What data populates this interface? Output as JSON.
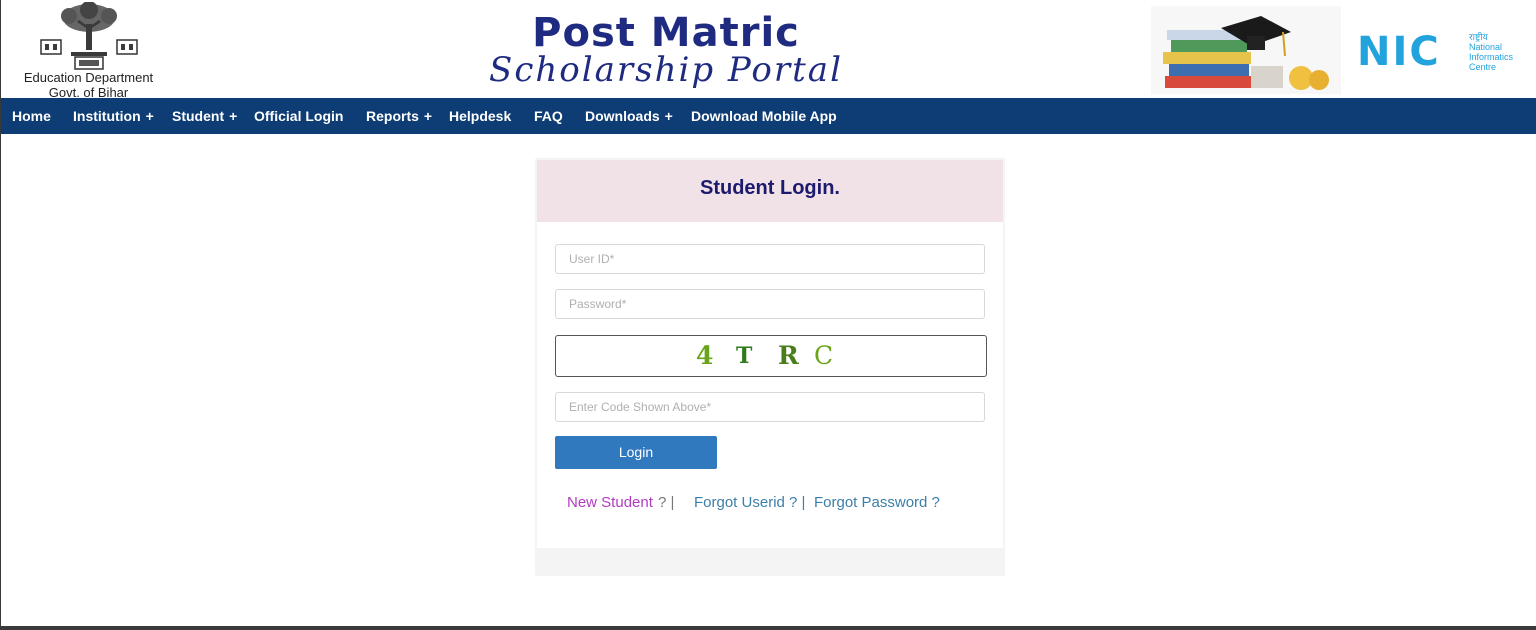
{
  "header": {
    "org_line1": "Education Department",
    "org_line2": "Govt. of Bihar",
    "title_main": "Post Matric",
    "title_sub": "Scholarship Portal",
    "nic_word": "NIC",
    "nic_small_1": "National",
    "nic_small_2": "Informatics",
    "nic_small_3": "Centre",
    "nic_hindi": "राष्ट्रीय"
  },
  "nav": {
    "items": [
      {
        "label": "Home",
        "has_submenu": false
      },
      {
        "label": "Institution",
        "has_submenu": true
      },
      {
        "label": "Student",
        "has_submenu": true
      },
      {
        "label": "Official Login",
        "has_submenu": false
      },
      {
        "label": "Reports",
        "has_submenu": true
      },
      {
        "label": "Helpdesk",
        "has_submenu": false
      },
      {
        "label": "FAQ",
        "has_submenu": false
      },
      {
        "label": "Downloads",
        "has_submenu": true
      },
      {
        "label": "Download Mobile App",
        "has_submenu": false
      }
    ],
    "submenu_glyph": "+"
  },
  "login": {
    "title": "Student Login.",
    "userid_placeholder": "User ID*",
    "password_placeholder": "Password*",
    "captcha_chars": [
      "4",
      "T",
      "R",
      "C"
    ],
    "captcha_placeholder": "Enter Code Shown Above*",
    "login_button": "Login",
    "links": {
      "new_student": "New Student",
      "new_student_sep": "? |",
      "forgot_userid": "Forgot Userid ? |",
      "forgot_password": "Forgot Password ?"
    }
  },
  "colors": {
    "navbar": "#0d3d74",
    "title": "#1e2b80",
    "login_header_bg": "#f0e2e6",
    "login_button": "#3079bf",
    "captcha_text": "#6aa31c",
    "new_student_link": "#b13cc0",
    "forgot_links": "#3c7fa8",
    "nic_blue": "#23a3dd"
  },
  "icons": {
    "emblem": "bodhi-tree-emblem-icon",
    "books": "books-graduation-cap-icon",
    "nic_logo": "nic-logo-icon"
  }
}
